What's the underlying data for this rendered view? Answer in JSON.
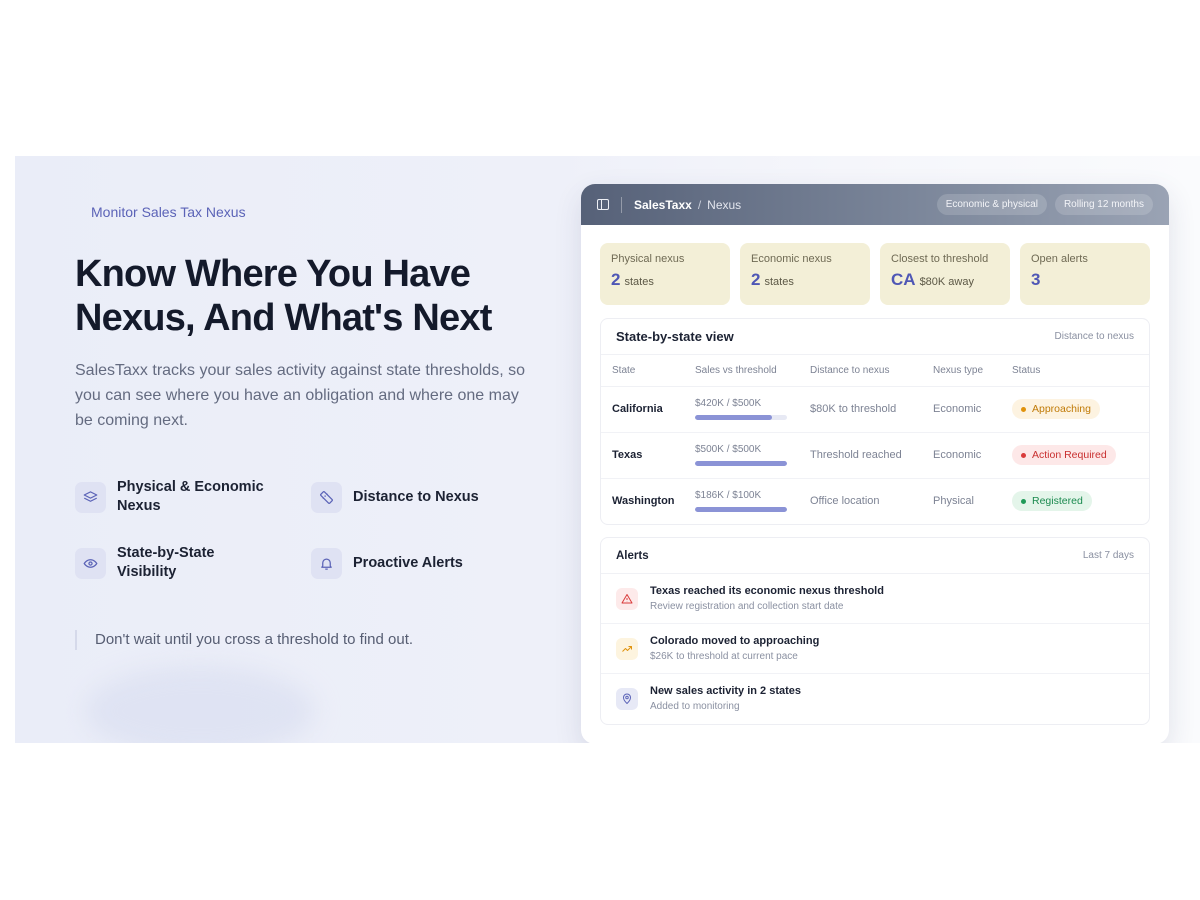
{
  "hero": {
    "eyebrow": "Monitor Sales Tax Nexus",
    "headline": "Know Where You Have Nexus, And What's Next",
    "lead": "SalesTaxx tracks your sales activity against state thresholds, so you can see where you have an obligation and where one may be coming next.",
    "features": [
      {
        "label": "Physical & Economic Nexus",
        "icon": "layers-icon"
      },
      {
        "label": "Distance to Nexus",
        "icon": "ruler-icon"
      },
      {
        "label": "State-by-State Visibility",
        "icon": "eye-icon"
      },
      {
        "label": "Proactive Alerts",
        "icon": "bell-icon"
      }
    ],
    "quote": "Don't wait until you cross a threshold to find out."
  },
  "app": {
    "brand": "SalesTaxx",
    "separator": "/",
    "crumb": "Nexus",
    "chips": [
      "Economic & physical",
      "Rolling 12 months"
    ],
    "stats": [
      {
        "label": "Physical nexus",
        "value": "2",
        "unit": "states"
      },
      {
        "label": "Economic nexus",
        "value": "2",
        "unit": "states"
      },
      {
        "label": "Closest to threshold",
        "value": "CA",
        "unit": "$80K away"
      },
      {
        "label": "Open alerts",
        "value": "3",
        "unit": ""
      }
    ],
    "table": {
      "title": "State-by-state view",
      "subtitle": "Distance to nexus",
      "columns": [
        "State",
        "Sales vs threshold",
        "Distance to nexus",
        "Nexus type",
        "Status"
      ],
      "rows": [
        {
          "state": "California",
          "sales": "$420K / $500K",
          "progress": 0.84,
          "distance": "$80K to threshold",
          "type": "Economic",
          "status": "Approaching"
        },
        {
          "state": "Texas",
          "sales": "$500K / $500K",
          "progress": 1.0,
          "distance": "Threshold reached",
          "type": "Economic",
          "status": "Action Required"
        },
        {
          "state": "Washington",
          "sales": "$186K / $100K",
          "progress": 1.0,
          "distance": "Office location",
          "type": "Physical",
          "status": "Registered"
        }
      ]
    },
    "alerts": {
      "title": "Alerts",
      "subtitle": "Last 7 days",
      "items": [
        {
          "title": "Texas reached its economic nexus threshold",
          "detail": "Review registration and collection start date",
          "icon": "warning-icon"
        },
        {
          "title": "Colorado moved to approaching",
          "detail": "$26K to threshold at current pace",
          "icon": "trending-up-icon"
        },
        {
          "title": "New sales activity in 2 states",
          "detail": "Added to monitoring",
          "icon": "map-pin-icon"
        }
      ]
    }
  },
  "colors": {
    "accent": "#4f57b5",
    "approaching": "#e0920c",
    "action_required": "#d93b3b",
    "registered": "#1f9a58",
    "stat_bg": "#f3efd7"
  }
}
